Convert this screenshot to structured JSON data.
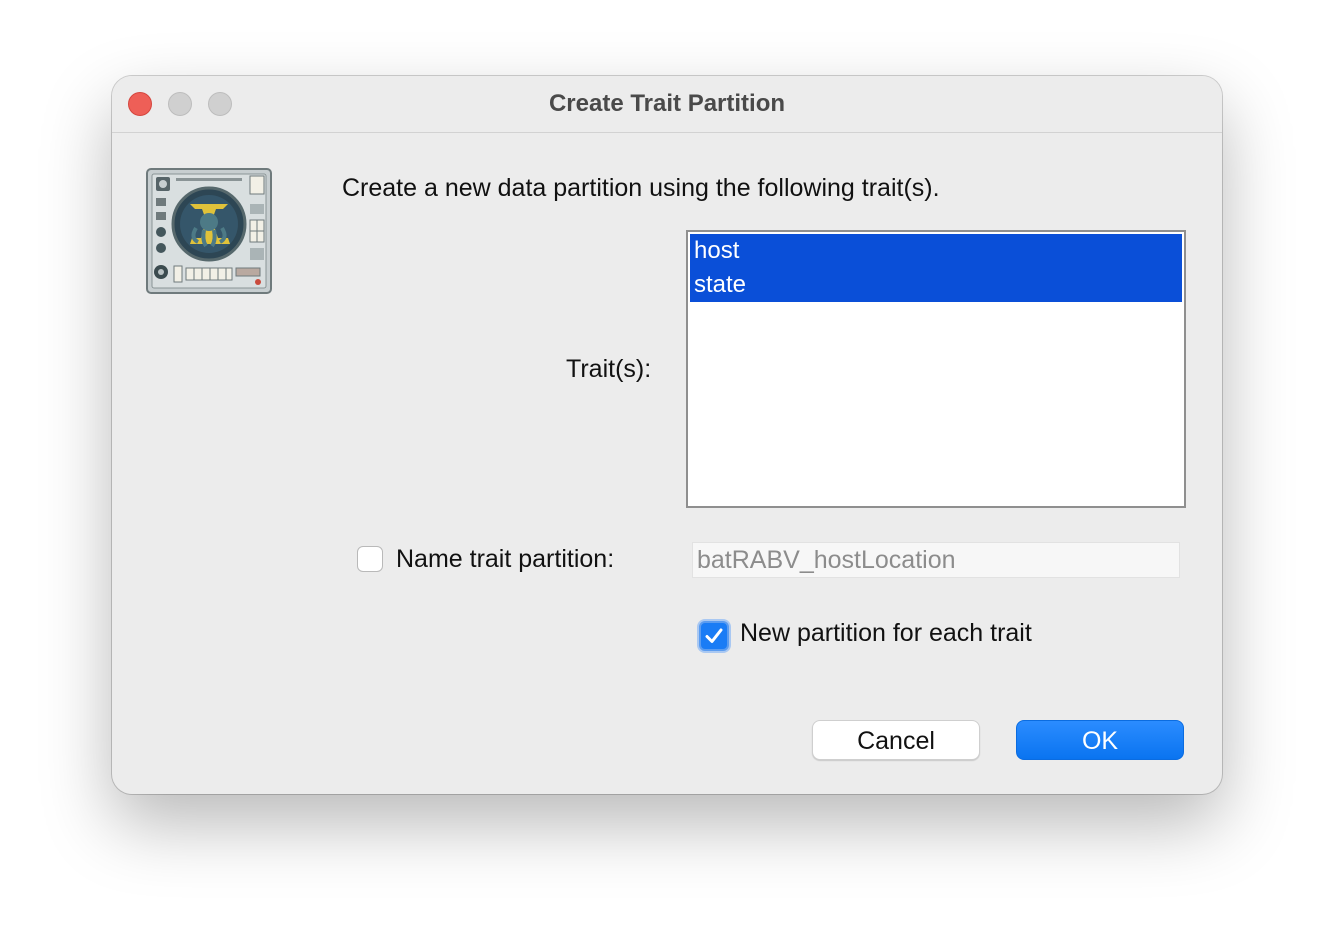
{
  "window": {
    "title": "Create Trait Partition"
  },
  "icon": {
    "name": "app-icon"
  },
  "prompt": "Create a new data partition using the following trait(s).",
  "traits": {
    "label": "Trait(s):",
    "items": [
      "host",
      "state"
    ],
    "selected": [
      "host",
      "state"
    ]
  },
  "name_partition": {
    "checked": false,
    "label": "Name trait partition:",
    "value": "batRABV_hostLocation"
  },
  "new_partition_each": {
    "checked": true,
    "label": "New partition for each trait"
  },
  "buttons": {
    "cancel": "Cancel",
    "ok": "OK"
  },
  "colors": {
    "selection": "#0a4fd8",
    "accent": "#1a7cf5",
    "close": "#ee5f57"
  }
}
